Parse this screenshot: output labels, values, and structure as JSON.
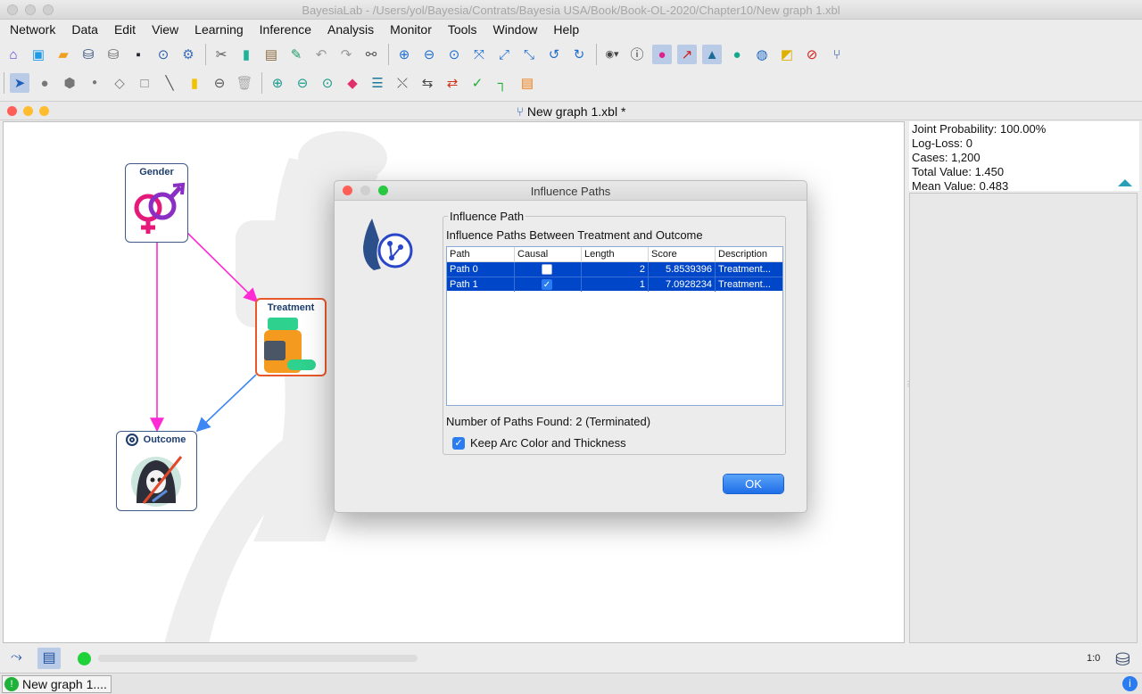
{
  "window": {
    "title": "BayesiaLab - /Users/yol/Bayesia/Contrats/Bayesia USA/Book/Book-OL-2020/Chapter10/New graph 1.xbl"
  },
  "menu": [
    "Network",
    "Data",
    "Edit",
    "View",
    "Learning",
    "Inference",
    "Analysis",
    "Monitor",
    "Tools",
    "Window",
    "Help"
  ],
  "toolbar1_icons": [
    "home-icon",
    "new-network-icon",
    "open-folder-icon",
    "database-icon",
    "database-export-icon",
    "save-icon",
    "search-dropdown-icon",
    "settings-icon",
    "cut-icon",
    "copy-icon",
    "paste-icon",
    "format-brush-icon",
    "undo-icon",
    "redo-icon",
    "binoculars-icon",
    "zoom-in-icon",
    "zoom-out-icon",
    "zoom-fit-icon",
    "fit-window-icon",
    "expand-icon",
    "collapse-icon",
    "rotate-left-icon",
    "rotate-right-icon",
    "node-style-icon",
    "info-icon",
    "target-node-icon",
    "arc-icon",
    "image-icon",
    "comment-icon",
    "globe-icon",
    "ruler-icon",
    "no-entry-icon",
    "graph-icon"
  ],
  "toolbar2_icons": [
    "pointer-icon",
    "circle-node-icon",
    "hexagon-node-icon",
    "small-node-icon",
    "diamond-node-icon",
    "square-node-icon",
    "arc-draw-icon",
    "note-icon",
    "remove-icon",
    "trash-icon",
    "zoom-add-icon",
    "zoom-remove-icon",
    "zoom-select-icon",
    "eraser-icon",
    "table-icon",
    "delete-arc-icon",
    "reverse-arc-icon",
    "swap-icon",
    "check-icon",
    "corner-icon",
    "report-icon"
  ],
  "frame": {
    "title": "New graph 1.xbl *"
  },
  "nodes": {
    "gender": "Gender",
    "treatment": "Treatment",
    "outcome": "Outcome"
  },
  "stats": {
    "joint_probability": "Joint Probability: 100.00%",
    "log_loss": "Log-Loss: 0",
    "cases": "Cases: 1,200",
    "total_value": "Total Value: 1.450",
    "mean_value": "Mean Value: 0.483"
  },
  "dialog": {
    "title": "Influence Paths",
    "group_title": "Influence Path",
    "subtitle": "Influence Paths Between Treatment and Outcome",
    "columns": [
      "Path",
      "Causal",
      "Length",
      "Score",
      "Description"
    ],
    "rows": [
      {
        "path": "Path 0",
        "causal": false,
        "length": "2",
        "score": "5.8539396",
        "description": "Treatment..."
      },
      {
        "path": "Path 1",
        "causal": true,
        "length": "1",
        "score": "7.0928234",
        "description": "Treatment..."
      }
    ],
    "paths_found": "Number of Paths Found: 2 (Terminated)",
    "keep_label": "Keep Arc Color and Thickness",
    "keep_checked": true,
    "ok_label": "OK"
  },
  "bottom": {
    "zoom_label": "1:0"
  },
  "taskbar": {
    "item": "New graph 1...."
  },
  "colors": {
    "accent": "#1e6ee8",
    "selection": "#0046c8",
    "arc_magenta": "#ff2ad4",
    "arc_blue": "#3d87f5"
  }
}
